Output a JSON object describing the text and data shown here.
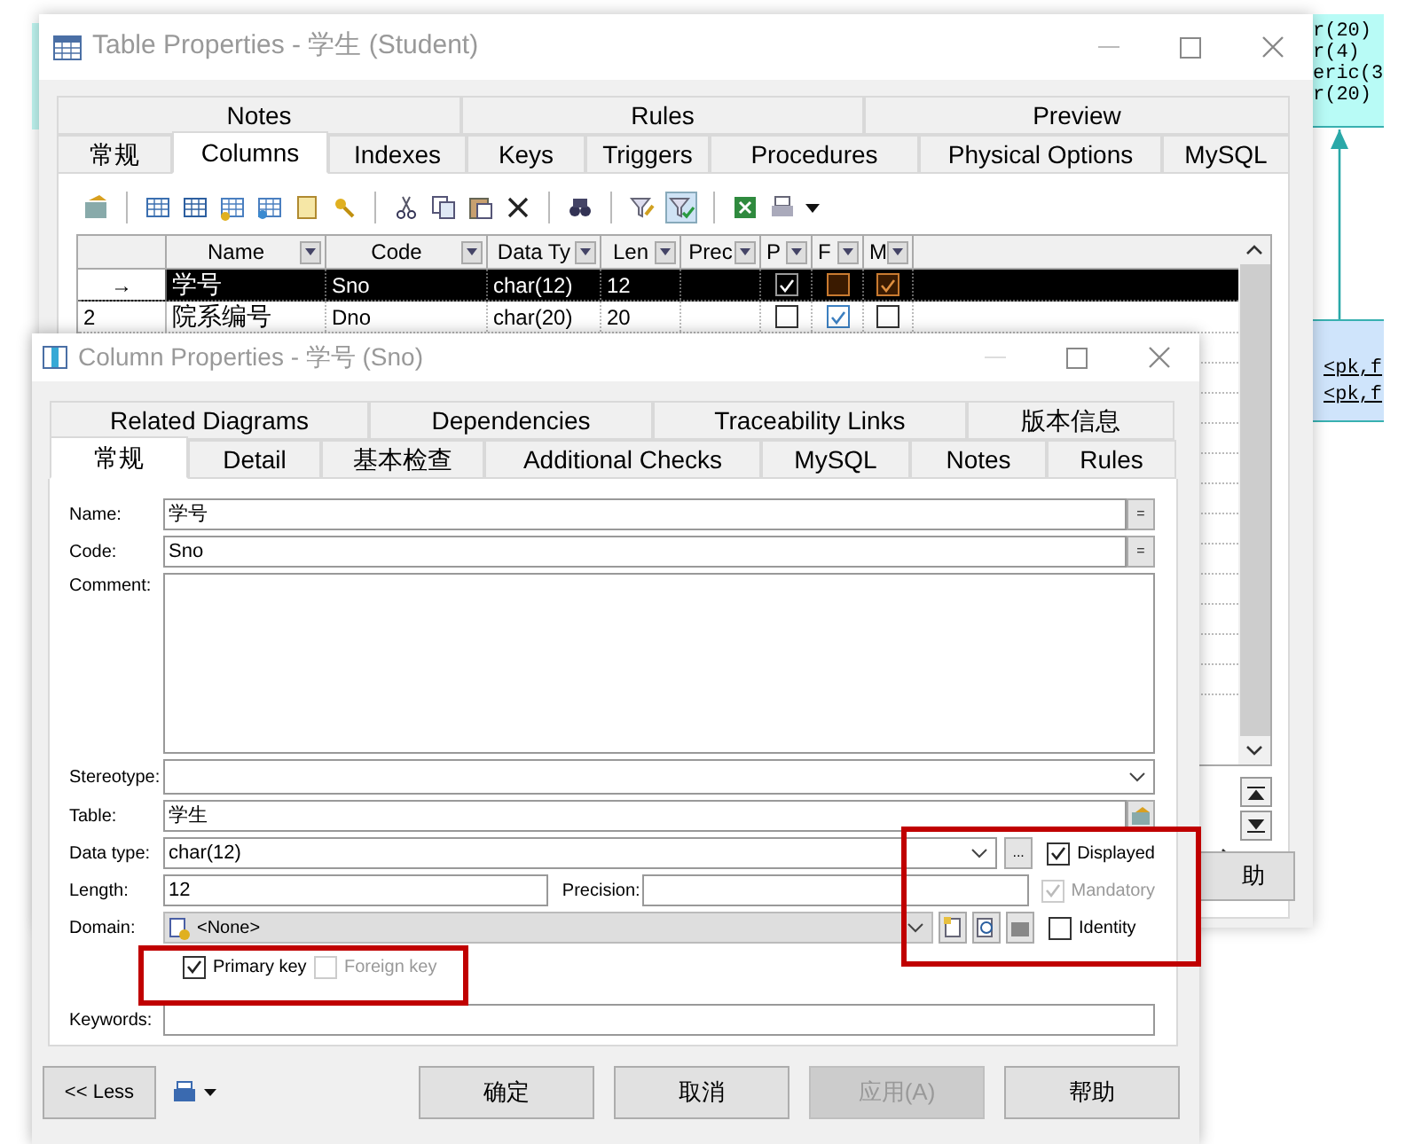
{
  "diagram": {
    "entity_lines": [
      "r(20)",
      "r(4)",
      "eric(3",
      "r(20)"
    ],
    "key_lines": [
      "<pk,f",
      "<pk,f"
    ]
  },
  "table_window": {
    "title": "Table Properties - 学生 (Student)",
    "tab_rows": [
      [
        {
          "label": "Notes",
          "selected": false
        },
        {
          "label": "Rules",
          "selected": false
        },
        {
          "label": "Preview",
          "selected": false
        }
      ],
      [
        {
          "label": "常规",
          "selected": false
        },
        {
          "label": "Columns",
          "selected": true
        },
        {
          "label": "Indexes",
          "selected": false
        },
        {
          "label": "Keys",
          "selected": false
        },
        {
          "label": "Triggers",
          "selected": false
        },
        {
          "label": "Procedures",
          "selected": false
        },
        {
          "label": "Physical Options",
          "selected": false
        },
        {
          "label": "MySQL",
          "selected": false
        }
      ]
    ],
    "grid": {
      "columns": [
        "Name",
        "Code",
        "Data Ty",
        "Len",
        "Prec",
        "P",
        "F",
        "M"
      ],
      "rows": [
        {
          "marker": "→",
          "name": "学号",
          "code": "Sno",
          "data_type": "char(12)",
          "length": "12",
          "primary": true,
          "foreign": false,
          "mandatory": true,
          "selected": true
        },
        {
          "marker": "2",
          "name": "院系编号",
          "code": "Dno",
          "data_type": "char(20)",
          "length": "20",
          "primary": false,
          "foreign": true,
          "mandatory": false,
          "selected": false
        }
      ]
    },
    "partial_button": "助"
  },
  "column_window": {
    "title": "Column Properties - 学号 (Sno)",
    "tab_rows": [
      [
        {
          "label": "Related Diagrams",
          "selected": false
        },
        {
          "label": "Dependencies",
          "selected": false
        },
        {
          "label": "Traceability Links",
          "selected": false
        },
        {
          "label": "版本信息",
          "selected": false
        }
      ],
      [
        {
          "label": "常规",
          "selected": true
        },
        {
          "label": "Detail",
          "selected": false
        },
        {
          "label": "基本检查",
          "selected": false
        },
        {
          "label": "Additional Checks",
          "selected": false
        },
        {
          "label": "MySQL",
          "selected": false
        },
        {
          "label": "Notes",
          "selected": false
        },
        {
          "label": "Rules",
          "selected": false
        }
      ]
    ],
    "labels": {
      "name": "Name:",
      "code": "Code:",
      "comment": "Comment:",
      "stereotype": "Stereotype:",
      "table": "Table:",
      "data_type": "Data type:",
      "length": "Length:",
      "precision": "Precision:",
      "domain": "Domain:",
      "keywords": "Keywords:"
    },
    "field_buttons": {
      "name": "=",
      "code": "=",
      "data_type": "..."
    },
    "values": {
      "name": "学号",
      "code": "Sno",
      "table": "学生",
      "data_type": "char(12)",
      "length": "12",
      "domain": "<None>"
    },
    "options": [
      {
        "label": "Displayed",
        "checked": true,
        "disabled": false
      },
      {
        "label": "Mandatory",
        "checked": true,
        "disabled": true
      },
      {
        "label": "Identity",
        "checked": false,
        "disabled": false
      }
    ],
    "keys": [
      {
        "label": "Primary key",
        "checked": true,
        "disabled": false
      },
      {
        "label": "Foreign key",
        "checked": false,
        "disabled": true
      }
    ],
    "buttons": [
      {
        "label": "<< Less",
        "disabled": false
      },
      {
        "label": "确定",
        "disabled": false
      },
      {
        "label": "取消",
        "disabled": false
      },
      {
        "label": "应用(A)",
        "disabled": true
      },
      {
        "label": "帮助",
        "disabled": false
      }
    ]
  }
}
